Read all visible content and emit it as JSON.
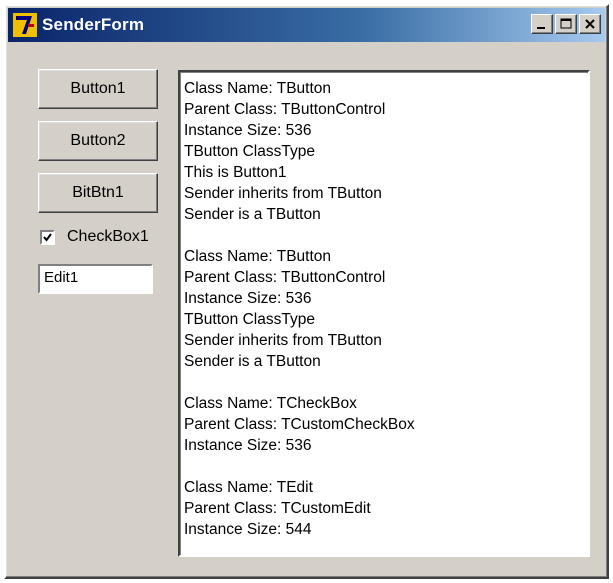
{
  "window": {
    "title": "SenderForm",
    "icon": "delphi-app-icon",
    "caption_buttons": [
      "minimize-icon",
      "maximize-icon",
      "close-icon"
    ]
  },
  "buttons": [
    {
      "label": "Button1"
    },
    {
      "label": "Button2"
    },
    {
      "label": "BitBtn1"
    }
  ],
  "checkbox": {
    "label": "CheckBox1",
    "checked": true
  },
  "edit": {
    "value": "Edit1"
  },
  "memo": {
    "lines": [
      "Class Name: TButton",
      "Parent Class: TButtonControl",
      "Instance Size: 536",
      "TButton ClassType",
      "This is Button1",
      "Sender inherits from TButton",
      "Sender is a TButton",
      "",
      "Class Name: TButton",
      "Parent Class: TButtonControl",
      "Instance Size: 536",
      "TButton ClassType",
      "Sender inherits from TButton",
      "Sender is a TButton",
      "",
      "Class Name: TCheckBox",
      "Parent Class: TCustomCheckBox",
      "Instance Size: 536",
      "",
      "Class Name: TEdit",
      "Parent Class: TCustomEdit",
      "Instance Size: 544"
    ]
  },
  "colors": {
    "face": "#d4d0c8",
    "title_start": "#0a246a",
    "title_end": "#a6caf0"
  }
}
